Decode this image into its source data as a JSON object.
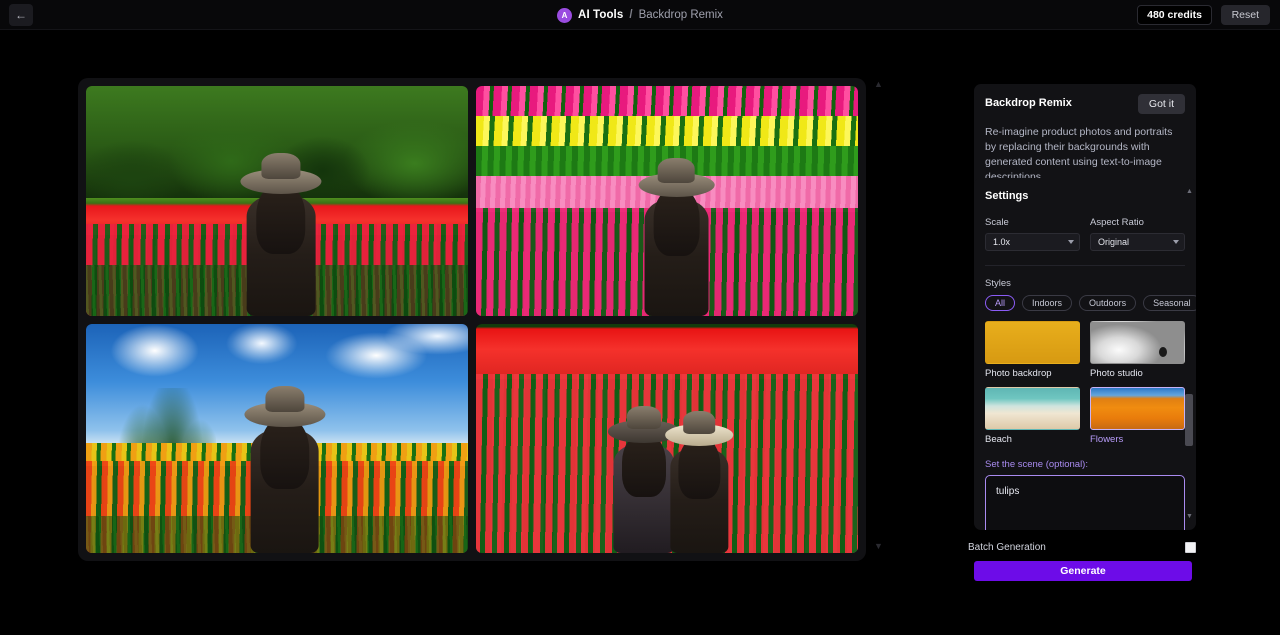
{
  "topbar": {
    "back_icon": "arrow-left-icon",
    "avatar_letter": "A",
    "breadcrumb_root": "AI Tools",
    "breadcrumb_separator": "/",
    "breadcrumb_current": "Backdrop Remix",
    "credits": "480 credits",
    "reset_label": "Reset"
  },
  "canvas": {
    "scroll_up_hint": "▲",
    "scroll_down_hint": "▼",
    "images": [
      {
        "alt": "woman in hat facing red and pink tulip field with green forest treeline"
      },
      {
        "alt": "woman in hat in pink tulip field with yellow and magenta tulip rows behind"
      },
      {
        "alt": "woman in hat in orange and red tulip field under blue sky with clouds"
      },
      {
        "alt": "two people in hats in pink, red and cream tulip field with red horizon band"
      }
    ]
  },
  "info_card": {
    "title": "Backdrop Remix",
    "got_it_label": "Got it",
    "description": "Re-imagine product photos and portraits by replacing their backgrounds with generated content using text-to-image descriptions."
  },
  "settings": {
    "title": "Settings",
    "scale_label": "Scale",
    "scale_value": "1.0x",
    "aspect_label": "Aspect Ratio",
    "aspect_value": "Original",
    "styles_label": "Styles",
    "chips": [
      {
        "label": "All",
        "active": true
      },
      {
        "label": "Indoors",
        "active": false
      },
      {
        "label": "Outdoors",
        "active": false
      },
      {
        "label": "Seasonal",
        "active": false
      }
    ],
    "thumbnails": [
      {
        "label": "Photo backdrop",
        "selected": false
      },
      {
        "label": "Photo studio",
        "selected": false
      },
      {
        "label": "Beach",
        "selected": false
      },
      {
        "label": "Flowers",
        "selected": true
      }
    ],
    "scene_label": "Set the scene (optional):",
    "scene_value": "tulips",
    "scene_placeholder": ""
  },
  "footer": {
    "batch_label": "Batch Generation",
    "batch_checked": false,
    "generate_label": "Generate"
  },
  "colors": {
    "accent_purple": "#6d0ce8",
    "chip_active": "#b79bf8",
    "selected_border": "#c7b2f5",
    "avatar": "#9a4ce0",
    "panel_bg": "#121215",
    "page_bg": "#000000"
  }
}
